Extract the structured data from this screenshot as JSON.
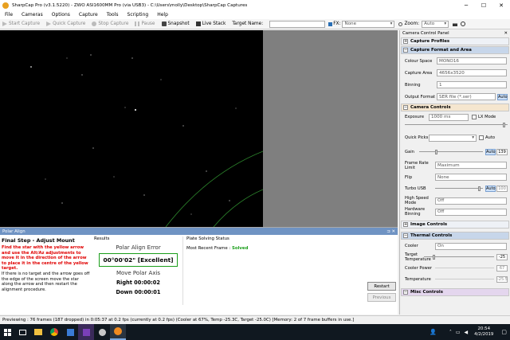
{
  "window": {
    "title": "SharpCap Pro (v3.1.5220) - ZWO ASI1600MM Pro (via USB3) - C:\\Users\\molly\\Desktop\\SharpCap Captures"
  },
  "menu": [
    "File",
    "Cameras",
    "Options",
    "Capture",
    "Tools",
    "Scripting",
    "Help"
  ],
  "toolbar": {
    "start_capture": "Start Capture",
    "quick_capture": "Quick Capture",
    "stop_capture": "Stop Capture",
    "pause": "Pause",
    "snapshot": "Snapshot",
    "live_stack": "Live Stack",
    "target_name_label": "Target Name:",
    "target_name_value": "",
    "fx_label": "FX:",
    "fx_value": "None",
    "zoom_label": "Zoom:",
    "zoom_value": "Auto"
  },
  "panel": {
    "title": "Camera Control Panel",
    "capture_profiles": "Capture Profiles",
    "capture_format_area": "Capture Format and Area",
    "colour_space_label": "Colour Space",
    "colour_space_value": "MONO16",
    "capture_area_label": "Capture Area",
    "capture_area_value": "4656x3520",
    "binning_label": "Binning",
    "binning_value": "1",
    "output_format_label": "Output Format",
    "output_format_value": "SER file (*.ser)",
    "output_format_auto": "Auto",
    "camera_controls": "Camera Controls",
    "exposure_label": "Exposure",
    "exposure_value": "1000 ms",
    "lx_mode": "LX Mode",
    "quick_picks_label": "Quick Picks",
    "quick_picks_auto": "Auto",
    "gain_label": "Gain",
    "gain_auto": "Auto",
    "gain_value": "139",
    "frame_rate_limit_label": "Frame Rate Limit",
    "frame_rate_limit_value": "Maximum",
    "flip_label": "Flip",
    "flip_value": "None",
    "turbo_usb_label": "Turbo USB",
    "turbo_usb_auto": "Auto",
    "turbo_usb_value": "100",
    "high_speed_mode_label": "High Speed Mode",
    "high_speed_mode_value": "Off",
    "hardware_binning_label": "Hardware Binning",
    "hardware_binning_value": "Off",
    "image_controls": "Image Controls",
    "thermal_controls": "Thermal Controls",
    "cooler_label": "Cooler",
    "cooler_value": "On",
    "target_temperature_label": "Target Temperature",
    "target_temperature_value": "-25",
    "cooler_power_label": "Cooler Power",
    "cooler_power_value": "67",
    "temperature_label": "Temperature",
    "temperature_value": "-25.5",
    "misc_controls": "Misc Controls"
  },
  "polar": {
    "title": "Polar Align",
    "step_title": "Final Step - Adjust Mount",
    "instructions_red": "Find the star with the yellow arrow and use the Alt/Az adjustments to move it in the direction of the arrow to place it in the centre of the yellow target.",
    "instructions_black": "If there is no target and the arrow goes off the edge of the screen move the star along the arrow and then restart the alignment procedure.",
    "results_label": "Results",
    "error_label": "Polar Align Error",
    "error_value": "00°00'02\"  [Excellent]",
    "move_label": "Move Polar Axis",
    "right_value": "Right 00:00:02",
    "down_value": "Down 00:00:01",
    "plate_label": "Plate Solving Status",
    "recent_frame_label": "Most Recent Frame :",
    "recent_frame_value": "Solved",
    "restart": "Restart",
    "previous": "Previous"
  },
  "status": {
    "text": "Previewing : 76 frames (187 dropped) in 0:05:37 at 0.2 fps  (currently at 0.2 fps)  (Cooler at 67%, Temp -25.3C, Target -25.0C) [Memory: 2 of 7 frame buffers in use.]"
  },
  "taskbar": {
    "time": "20:54",
    "date": "4/2/2019"
  },
  "colors": {
    "accent": "#6f93c3",
    "solved": "#1a9e1a",
    "warning_text": "#e00000",
    "excellent_border": "#1a9e1a"
  }
}
